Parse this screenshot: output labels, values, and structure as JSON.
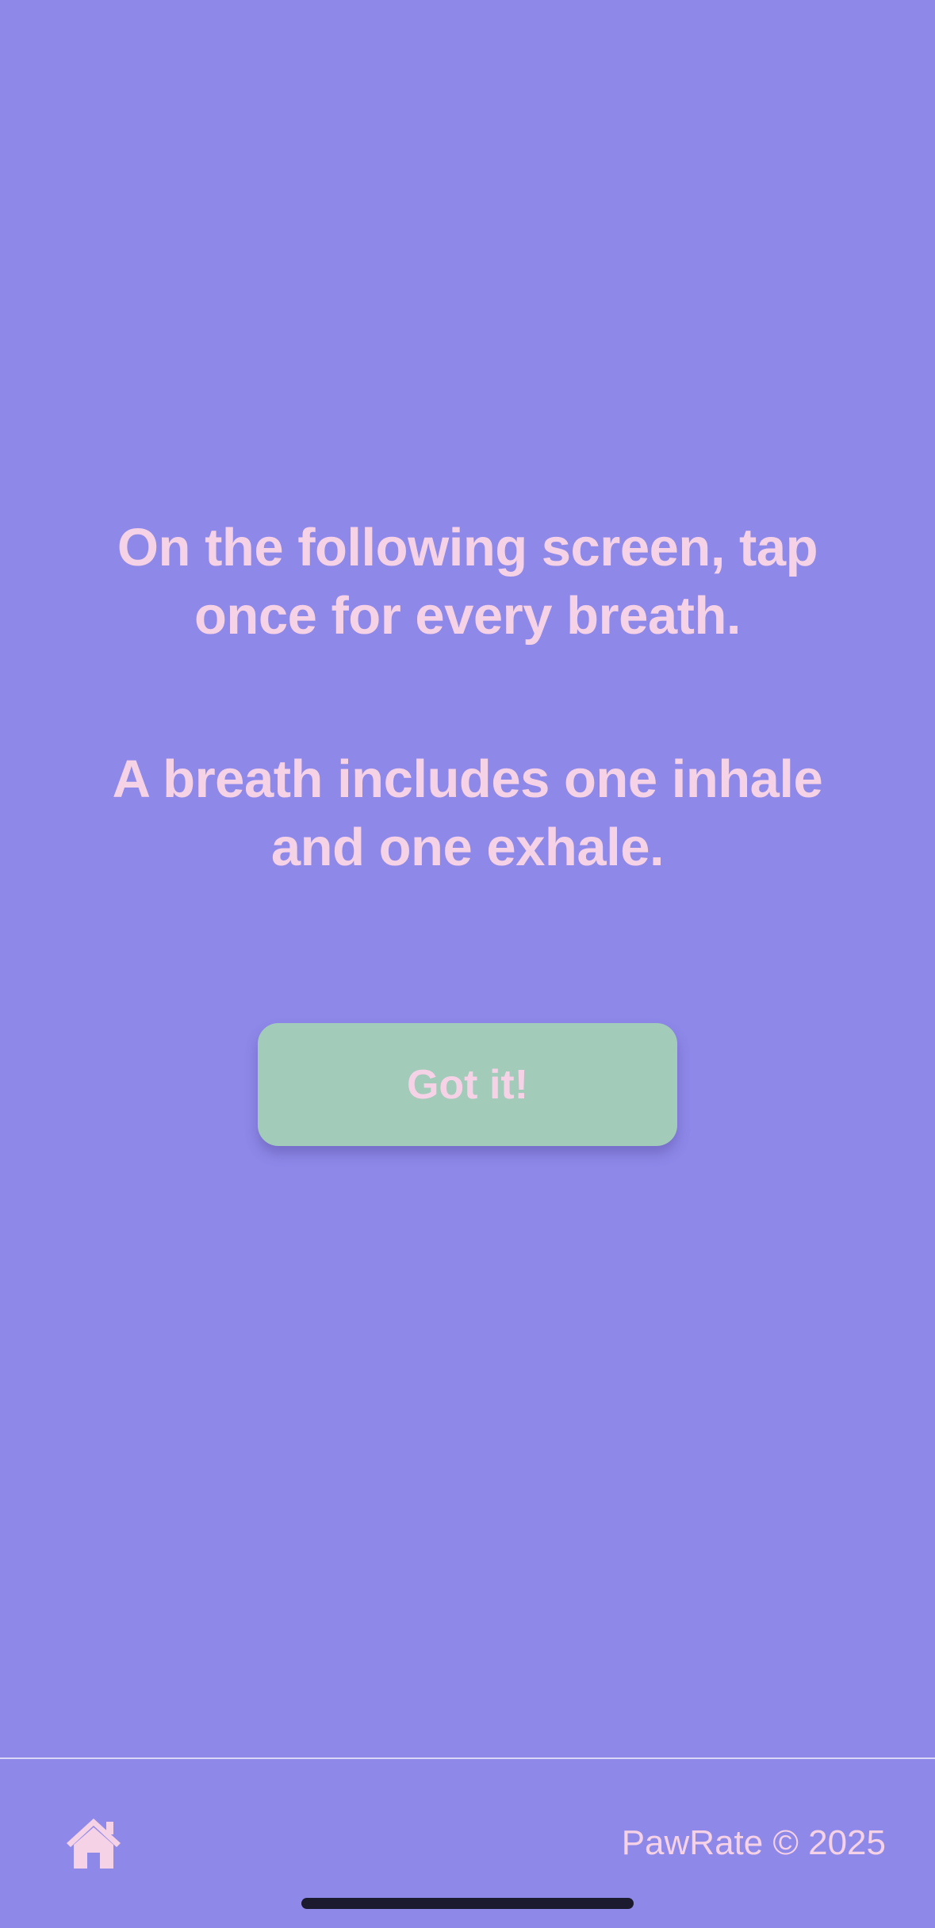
{
  "instructions": {
    "line1": "On the following screen, tap once for every breath.",
    "line2": "A breath includes one inhale and one exhale."
  },
  "actions": {
    "confirm_label": "Got it!"
  },
  "footer": {
    "home_icon": "home-icon",
    "copyright": "PawRate © 2025"
  },
  "colors": {
    "background": "#8e88e9",
    "text": "#f6d2e6",
    "button": "#a2cbb9"
  }
}
